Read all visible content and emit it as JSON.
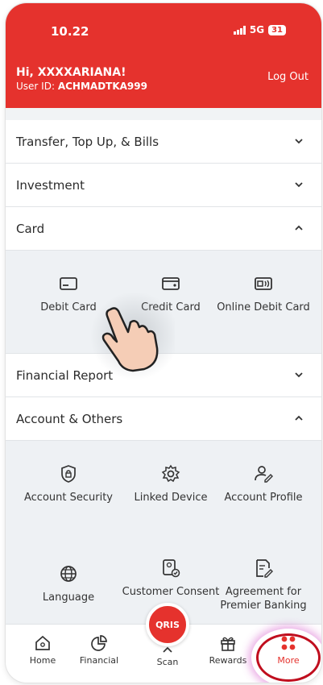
{
  "status": {
    "time": "10.22",
    "network": "5G",
    "battery": "31"
  },
  "header": {
    "greeting": "Hi, XXXXARIANA!",
    "user_id_label": "User ID:",
    "user_id": "ACHMADTKA999",
    "logout": "Log Out"
  },
  "sections": {
    "transfer": "Transfer, Top Up, & Bills",
    "investment": "Investment",
    "card": "Card",
    "financial_report": "Financial Report",
    "account_others": "Account & Others"
  },
  "card_items": [
    {
      "label": "Debit Card",
      "icon": "debit-card-icon"
    },
    {
      "label": "Credit Card",
      "icon": "credit-card-icon"
    },
    {
      "label": "Online Debit Card",
      "icon": "online-debit-card-icon"
    }
  ],
  "account_items": [
    {
      "label": "Account Security",
      "icon": "shield-lock-icon"
    },
    {
      "label": "Linked Device",
      "icon": "gear-icon"
    },
    {
      "label": "Account Profile",
      "icon": "user-edit-icon"
    },
    {
      "label": "Language",
      "icon": "globe-icon"
    },
    {
      "label": "Customer Consent",
      "icon": "consent-icon"
    },
    {
      "label": "Agreement for Premier Banking",
      "icon": "document-edit-icon"
    }
  ],
  "nav": {
    "home": "Home",
    "financial": "Financial",
    "scan": "Scan",
    "scan_logo": "QRIS",
    "rewards": "Rewards",
    "more": "More"
  },
  "colors": {
    "brand": "#e5322d",
    "highlight": "#c00e1e"
  }
}
